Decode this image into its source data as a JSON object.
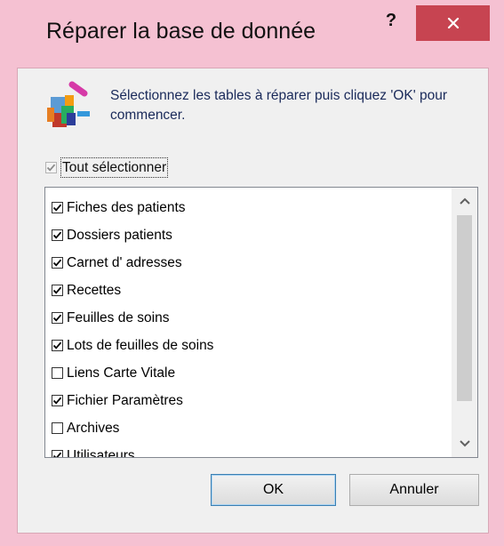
{
  "window": {
    "title": "Réparer la base de donnée",
    "help_label": "?",
    "colors": {
      "frame": "#f5c1d2",
      "close": "#c74451",
      "client": "#f0f0f0"
    }
  },
  "dialog": {
    "instructions": "Sélectionnez les tables à réparer puis cliquez 'OK' pour commencer.",
    "select_all": {
      "label": "Tout sélectionner",
      "checked": true,
      "disabled": true
    },
    "tables": [
      {
        "label": "Fiches des patients",
        "checked": true
      },
      {
        "label": "Dossiers patients",
        "checked": true
      },
      {
        "label": "Carnet d' adresses",
        "checked": true
      },
      {
        "label": "Recettes",
        "checked": true
      },
      {
        "label": "Feuilles de soins",
        "checked": true
      },
      {
        "label": "Lots de feuilles de soins",
        "checked": true
      },
      {
        "label": "Liens Carte Vitale",
        "checked": false
      },
      {
        "label": "Fichier Paramètres",
        "checked": true
      },
      {
        "label": "Archives",
        "checked": false
      },
      {
        "label": "Utilisateurs",
        "checked": true
      }
    ],
    "ok_label": "OK",
    "cancel_label": "Annuler"
  },
  "icons": {
    "app": "database-repair-icon",
    "close": "close-icon",
    "scroll_up": "chevron-up-icon",
    "scroll_down": "chevron-down-icon",
    "check": "check-icon"
  }
}
